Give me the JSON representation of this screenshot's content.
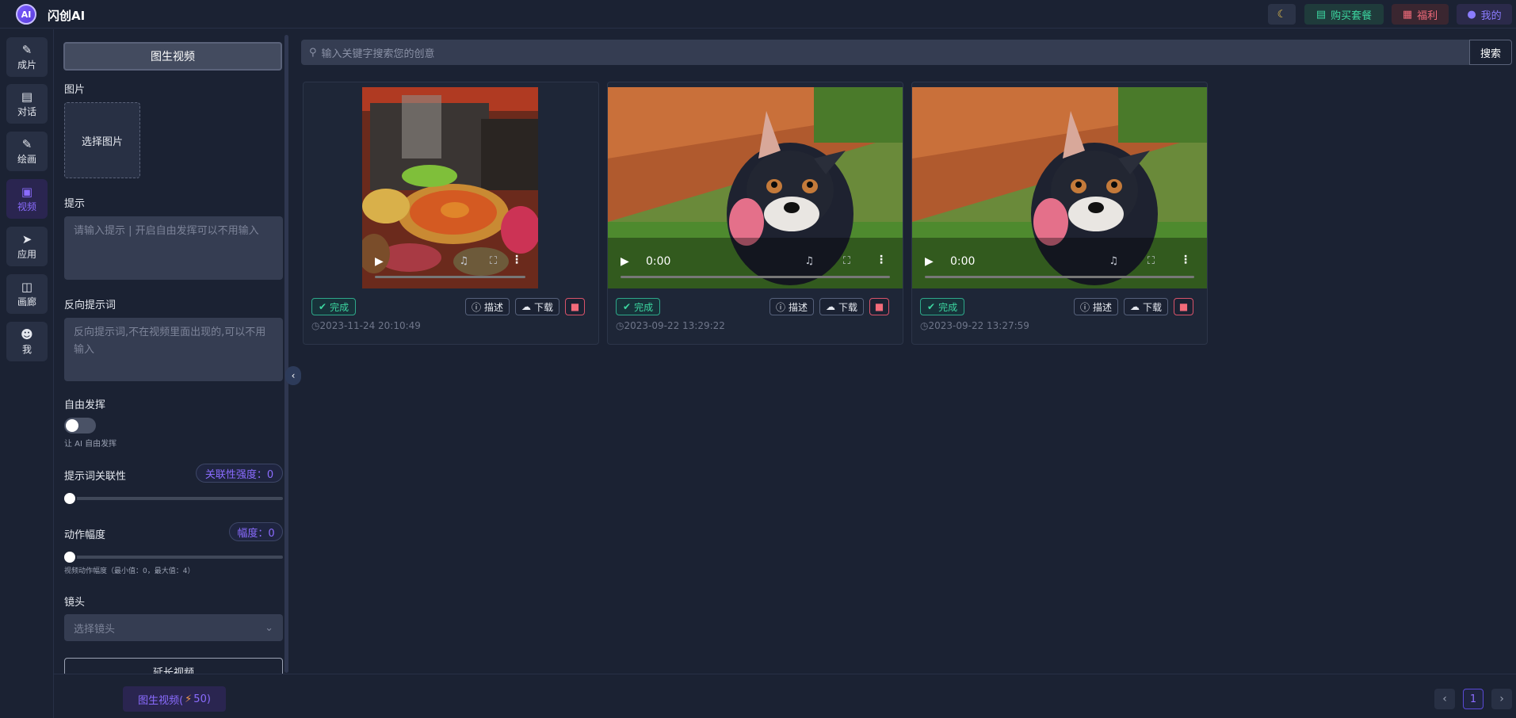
{
  "app": {
    "title": "闪创AI",
    "logo_text": "AI"
  },
  "header": {
    "moon_icon": "moon-icon",
    "buy_label": "购买套餐",
    "welfare_label": "福利",
    "me_label": "我的",
    "colors": {
      "buy": "#3cd6a0",
      "welfare": "#f26b7a",
      "me": "#8b7cff"
    }
  },
  "nav": {
    "items": [
      {
        "label": "成片",
        "icon": "edit-icon"
      },
      {
        "label": "对话",
        "icon": "chat-icon"
      },
      {
        "label": "绘画",
        "icon": "brush-icon"
      },
      {
        "label": "视频",
        "icon": "video-icon",
        "active": true
      },
      {
        "label": "应用",
        "icon": "rocket-icon"
      },
      {
        "label": "画廊",
        "icon": "gallery-icon"
      },
      {
        "label": "我",
        "icon": "user-icon"
      }
    ]
  },
  "panel": {
    "mode_tab": "图生视频",
    "image_label": "图片",
    "upload_label": "选择图片",
    "prompt_label": "提示",
    "prompt_placeholder": "请输入提示 | 开启自由发挥可以不用输入",
    "negative_label": "反向提示词",
    "negative_placeholder": "反向提示词,不在视频里面出现的,可以不用输入",
    "free_label": "自由发挥",
    "free_note": "让 AI 自由发挥",
    "free_enabled": false,
    "relevance_label": "提示词关联性",
    "relevance_badge": "关联性强度：0",
    "relevance_value": 0,
    "motion_label": "动作幅度",
    "motion_badge": "幅度：0",
    "motion_value": 0,
    "motion_note": "视频动作幅度（最小值：0，最大值：4）",
    "lens_label": "镜头",
    "lens_placeholder": "选择镜头",
    "extend_label": "延长视频"
  },
  "search": {
    "placeholder": "输入关键字搜索您的创意",
    "button": "搜索"
  },
  "cards": [
    {
      "type": "image",
      "subject": "hotpot-image",
      "status": "完成",
      "describe": "描述",
      "download": "下载",
      "time": "2023-11-24 20:10:49"
    },
    {
      "type": "video",
      "subject": "dog-video",
      "status": "完成",
      "describe": "描述",
      "download": "下载",
      "time": "2023-09-22 13:29:22",
      "time_display": "0:00"
    },
    {
      "type": "video",
      "subject": "dog-video",
      "status": "完成",
      "describe": "描述",
      "download": "下载",
      "time": "2023-09-22 13:27:59",
      "time_display": "0:00"
    }
  ],
  "footer": {
    "generate_label": "图生视频(",
    "bolt_icon": "lightning-icon",
    "cost": "50)",
    "page": "1"
  }
}
